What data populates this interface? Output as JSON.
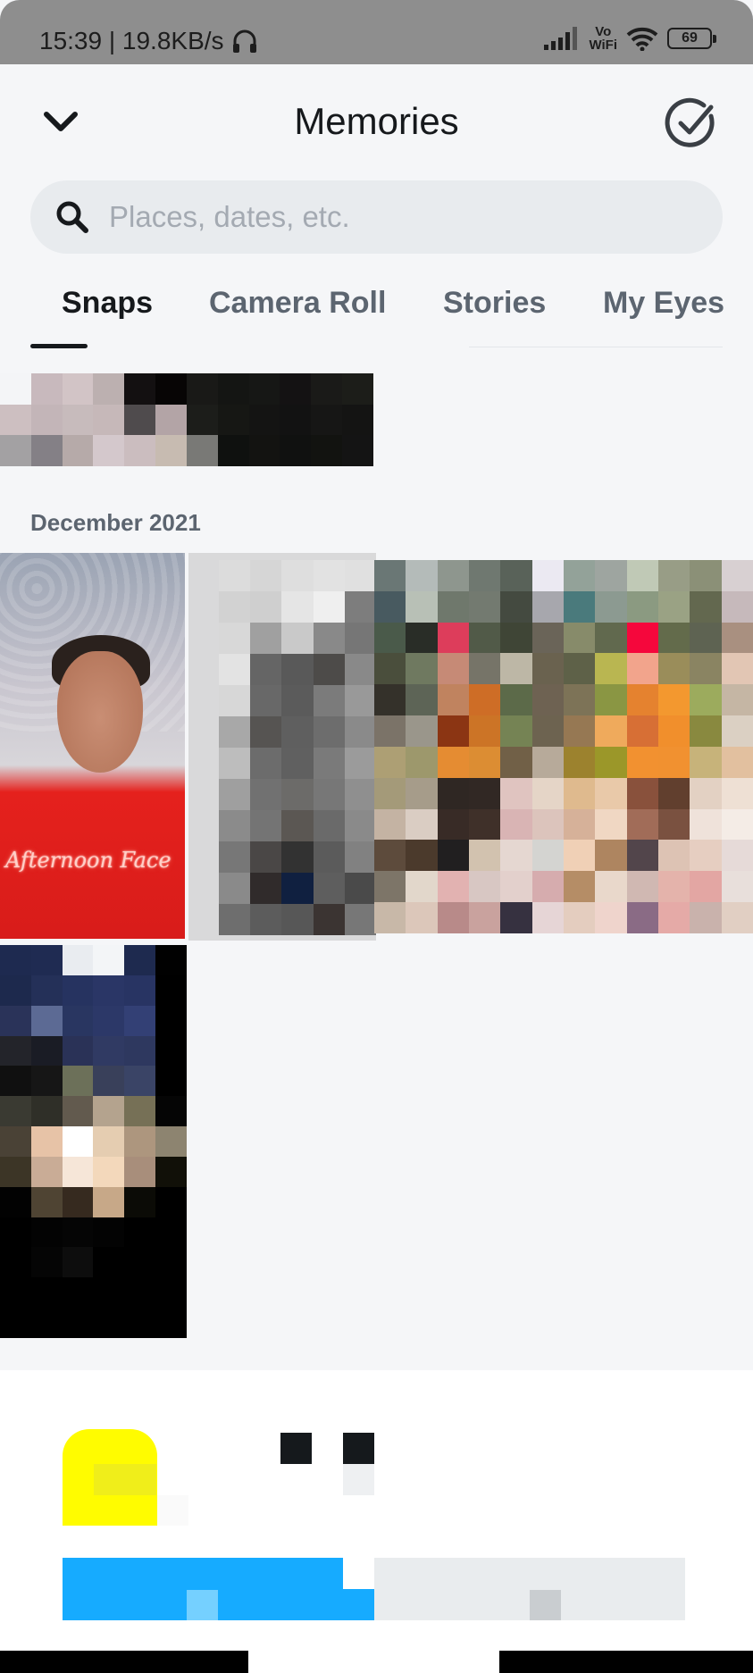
{
  "status_bar": {
    "time_speed": "15:39 | 19.8KB/s",
    "vowifi_top": "Vo",
    "vowifi_bottom": "WiFi",
    "battery": "69",
    "icons": [
      "headphones-icon",
      "signal-icon",
      "wifi-icon",
      "battery-icon"
    ]
  },
  "header": {
    "title": "Memories",
    "back_icon": "chevron-down-icon",
    "select_icon": "check-circle-icon"
  },
  "search": {
    "placeholder": "Places, dates, etc.",
    "icon": "search-icon"
  },
  "tabs": [
    {
      "label": "Snaps",
      "active": true
    },
    {
      "label": "Camera Roll",
      "active": false
    },
    {
      "label": "Stories",
      "active": false
    },
    {
      "label": "My Eyes",
      "active": false
    }
  ],
  "sections": [
    {
      "label": "December 2021"
    }
  ],
  "thumbnails": {
    "photo_face_caption": "Afternoon Face"
  },
  "colors": {
    "background": "#f5f6f8",
    "status_bar": "#8e8e8e",
    "search_bg": "#e8ebee",
    "text_primary": "#16191c",
    "text_secondary": "#5c6570"
  }
}
